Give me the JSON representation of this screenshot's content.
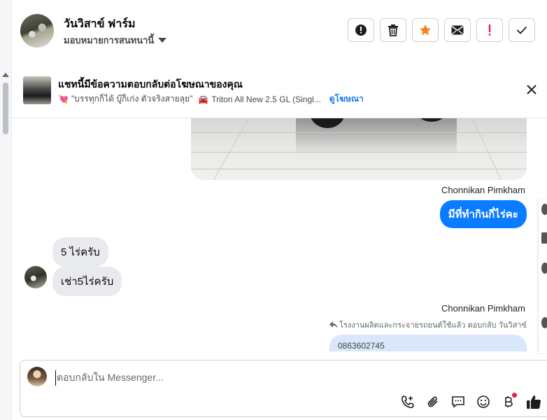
{
  "header": {
    "contact_name": "วันวิสาข์ ฟาร์ม",
    "assign_label": "มอบหมายการสนทนานี้",
    "actions": [
      {
        "name": "report-button",
        "icon": "alert-circle-icon"
      },
      {
        "name": "delete-button",
        "icon": "trash-icon"
      },
      {
        "name": "star-button",
        "icon": "star-icon",
        "color": "#f5831f"
      },
      {
        "name": "mark-unread-button",
        "icon": "envelope-icon"
      },
      {
        "name": "spam-button",
        "icon": "exclamation-icon",
        "color": "#e41e3f"
      },
      {
        "name": "done-button",
        "icon": "check-icon"
      }
    ]
  },
  "ad_banner": {
    "title": "แชทนี้มีข้อความตอบกลับต่อโฆษณาของคุณ",
    "ad_caption": "\"บรรทุกก็ได้ บู๊ก็เก่ง ตัวจริงสายลุย\"",
    "car_model": "Triton All New 2.5 GL (Singl...",
    "view_ad_link": "ดูโฆษณา",
    "caption_emoji": "💘",
    "car_emoji": "🚘"
  },
  "messages": {
    "sender_1": "Chonnikan Pimkham",
    "outgoing_1": "มีที่ทำกินกี่ไร่คะ",
    "incoming_1": "5 ไร่ครับ",
    "incoming_2": "เช่า5ไร่ครับ",
    "sender_2": "Chonnikan Pimkham",
    "reply_note": "โรงงานผลิตและกระจายรถยนต์ใช้แล้ว ตอบกลับ วันวิสาข์",
    "outgoing_2_partial": "0863602745"
  },
  "composer": {
    "placeholder": "ตอบกลับใน Messenger...",
    "icons": [
      "call-add-icon",
      "attach-icon",
      "saved-reply-icon",
      "emoji-icon",
      "baht-payment-icon",
      "like-icon"
    ]
  },
  "colors": {
    "accent": "#0a7cff",
    "link": "#1877f2",
    "star": "#f5831f",
    "danger": "#e41e3f",
    "incoming_bubble": "#e9eaed",
    "quoted_bubble": "#d8e7fb"
  }
}
